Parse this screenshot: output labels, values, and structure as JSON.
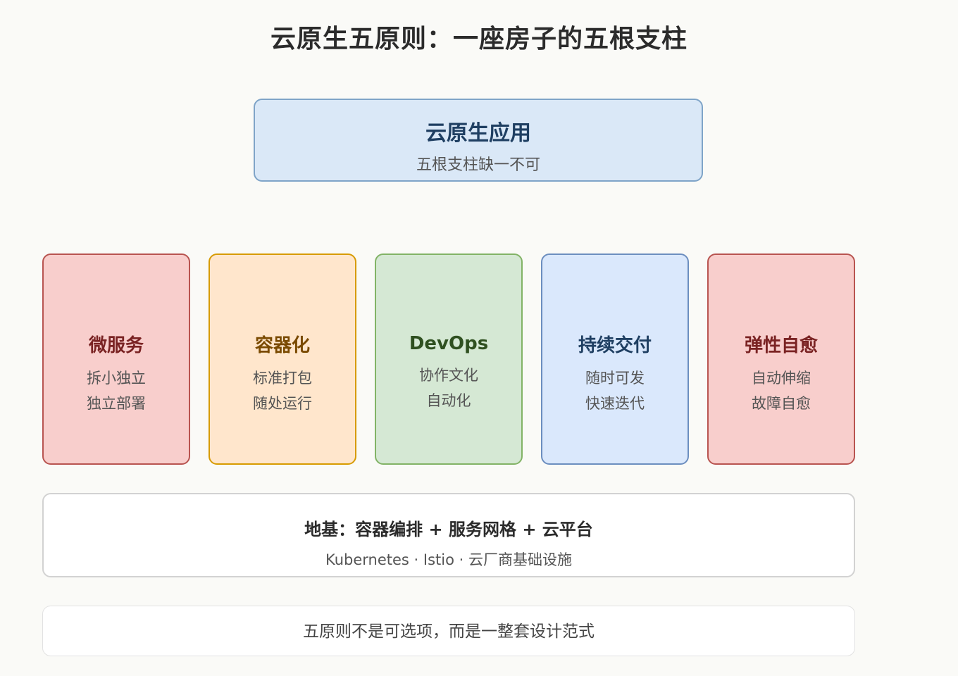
{
  "title": "云原生五原则：一座房子的五根支柱",
  "roof": {
    "title": "云原生应用",
    "subtitle": "五根支柱缺一不可"
  },
  "pillars": [
    {
      "name": "微服务",
      "line1": "拆小独立",
      "line2": "独立部署",
      "color": "#7a2323",
      "fill": "#f8cecc",
      "border": "#b85450"
    },
    {
      "name": "容器化",
      "line1": "标准打包",
      "line2": "随处运行",
      "color": "#7a4a00",
      "fill": "#ffe6cc",
      "border": "#d79b00"
    },
    {
      "name": "DevOps",
      "line1": "协作文化",
      "line2": "自动化",
      "color": "#2f5020",
      "fill": "#d5e8d4",
      "border": "#82b366"
    },
    {
      "name": "持续交付",
      "line1": "随时可发",
      "line2": "快速迭代",
      "color": "#1f3f62",
      "fill": "#dae8fc",
      "border": "#6c8ebf"
    },
    {
      "name": "弹性自愈",
      "line1": "自动伸缩",
      "line2": "故障自愈",
      "color": "#7a2323",
      "fill": "#f8cecc",
      "border": "#b85450"
    }
  ],
  "foundation": {
    "title": "地基：容器编排 + 服务网格 + 云平台",
    "subtitle": "Kubernetes · Istio · 云厂商基础设施"
  },
  "footer": {
    "text": "五原则不是可选项，而是一整套设计范式"
  }
}
